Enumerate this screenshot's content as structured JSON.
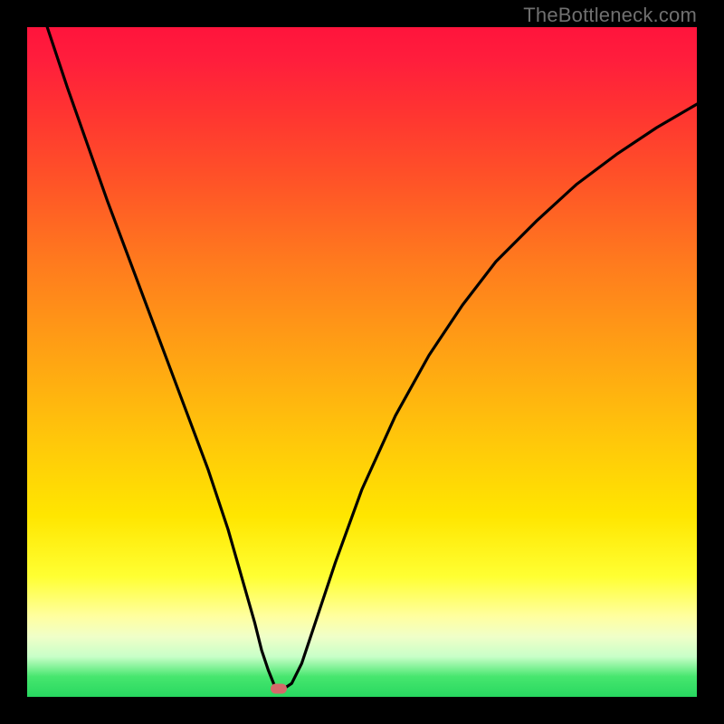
{
  "attribution": "TheBottleneck.com",
  "chart_data": {
    "type": "line",
    "title": "",
    "xlabel": "",
    "ylabel": "",
    "xlim": [
      0,
      100
    ],
    "ylim": [
      0,
      100
    ],
    "series": [
      {
        "name": "curve",
        "x": [
          3,
          6,
          9,
          12,
          15,
          18,
          21,
          24,
          27,
          30,
          32,
          34,
          35,
          36,
          37,
          38,
          39.5,
          41,
          43,
          46,
          50,
          55,
          60,
          65,
          70,
          76,
          82,
          88,
          94,
          100
        ],
        "y": [
          100,
          91,
          82.5,
          74,
          66,
          58,
          50,
          42,
          34,
          25,
          18,
          11,
          7,
          4,
          1.5,
          1,
          2,
          5,
          11,
          20,
          31,
          42,
          51,
          58.5,
          65,
          71,
          76.5,
          81,
          85,
          88.5
        ]
      }
    ],
    "marker": {
      "x": 37.5,
      "y": 1.2
    },
    "gradient_stops": [
      {
        "pct": 0,
        "color": "#ff143c"
      },
      {
        "pct": 50,
        "color": "#ffa014"
      },
      {
        "pct": 82,
        "color": "#ffff32"
      },
      {
        "pct": 100,
        "color": "#28d860"
      }
    ]
  }
}
